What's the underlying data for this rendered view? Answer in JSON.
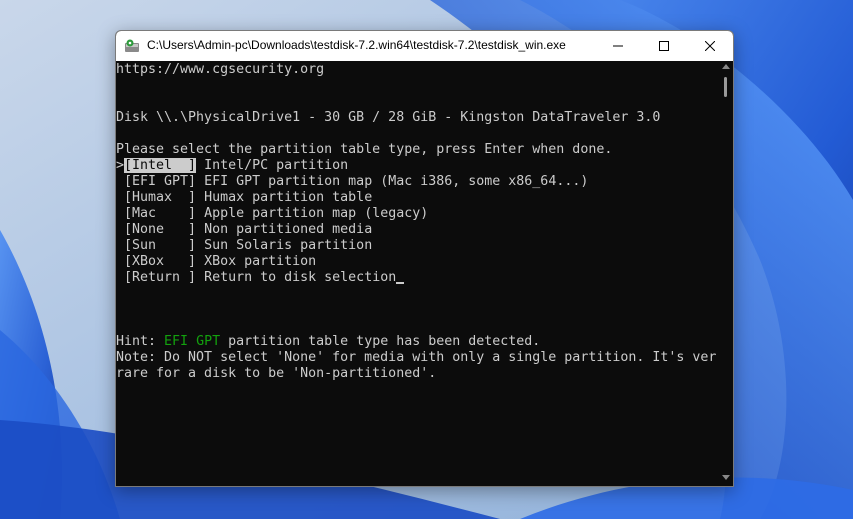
{
  "window": {
    "title": "C:\\Users\\Admin-pc\\Downloads\\testdisk-7.2.win64\\testdisk-7.2\\testdisk_win.exe",
    "icon": "testdisk-app-icon",
    "controls": {
      "minimize": "minimize-icon",
      "maximize": "maximize-icon",
      "close": "close-icon"
    }
  },
  "terminal": {
    "url": "https://www.cgsecurity.org",
    "disk": "Disk \\\\.\\PhysicalDrive1 - 30 GB / 28 GiB - Kingston DataTraveler 3.0",
    "prompt": "Please select the partition table type, press Enter when done.",
    "options": [
      {
        "pointer": ">",
        "key": "[Intel  ]",
        "desc": " Intel/PC partition",
        "selected": true
      },
      {
        "pointer": " ",
        "key": "[EFI GPT]",
        "desc": " EFI GPT partition map (Mac i386, some x86_64...)",
        "selected": false
      },
      {
        "pointer": " ",
        "key": "[Humax  ]",
        "desc": " Humax partition table",
        "selected": false
      },
      {
        "pointer": " ",
        "key": "[Mac    ]",
        "desc": " Apple partition map (legacy)",
        "selected": false
      },
      {
        "pointer": " ",
        "key": "[None   ]",
        "desc": " Non partitioned media",
        "selected": false
      },
      {
        "pointer": " ",
        "key": "[Sun    ]",
        "desc": " Sun Solaris partition",
        "selected": false
      },
      {
        "pointer": " ",
        "key": "[XBox   ]",
        "desc": " XBox partition",
        "selected": false
      },
      {
        "pointer": " ",
        "key": "[Return ]",
        "desc": " Return to disk selection",
        "selected": false
      }
    ],
    "hint_prefix": "Hint: ",
    "hint_highlight": "EFI GPT",
    "hint_suffix": " partition table type has been detected.",
    "note_line1": "Note: Do NOT select 'None' for media with only a single partition. It's ver",
    "note_line2": "rare for a disk to be 'Non-partitioned'."
  },
  "colors": {
    "terminal_bg": "#0c0c0c",
    "terminal_fg": "#cccccc",
    "hint_green": "#13a10e",
    "wallpaper_blue": "#1f5fd6"
  }
}
